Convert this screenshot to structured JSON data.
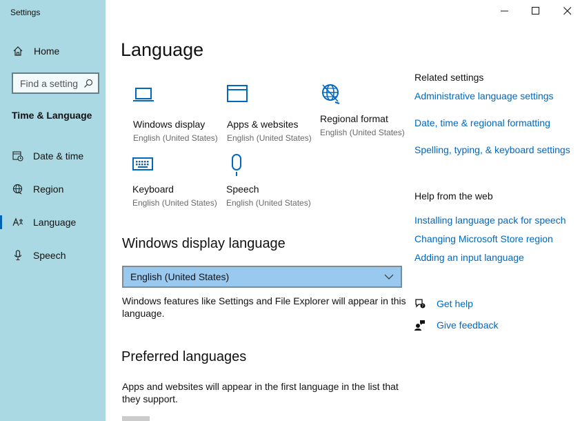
{
  "window": {
    "app_title": "Settings"
  },
  "sidebar": {
    "home_label": "Home",
    "search_placeholder": "Find a setting",
    "section_title": "Time & Language",
    "items": [
      {
        "label": "Date & time",
        "icon": "calendar-clock-icon"
      },
      {
        "label": "Region",
        "icon": "globe-icon"
      },
      {
        "label": "Language",
        "icon": "language-icon",
        "active": true
      },
      {
        "label": "Speech",
        "icon": "microphone-icon"
      }
    ]
  },
  "main": {
    "title": "Language",
    "tiles": [
      {
        "name": "Windows display",
        "sub": "English (United States)",
        "icon": "monitor-icon"
      },
      {
        "name": "Apps & websites",
        "sub": "English (United States)",
        "icon": "window-icon"
      },
      {
        "name": "Regional format",
        "sub": "English (United States)",
        "icon": "regional-globe-icon"
      },
      {
        "name": "Keyboard",
        "sub": "English (United States)",
        "icon": "keyboard-icon"
      },
      {
        "name": "Speech",
        "sub": "English (United States)",
        "icon": "microphone-icon"
      }
    ],
    "display_language": {
      "heading": "Windows display language",
      "selected": "English (United States)",
      "description": "Windows features like Settings and File Explorer will appear in this language."
    },
    "preferred": {
      "heading": "Preferred languages",
      "description": "Apps and websites will appear in the first language in the list that they support."
    }
  },
  "related": {
    "title": "Related settings",
    "links": [
      "Administrative language settings",
      "Date, time & regional formatting",
      "Spelling, typing, & keyboard settings"
    ]
  },
  "help_web": {
    "title": "Help from the web",
    "links": [
      "Installing language pack for speech",
      "Changing Microsoft Store region",
      "Adding an input language"
    ]
  },
  "support": {
    "get_help": "Get help",
    "give_feedback": "Give feedback"
  },
  "colors": {
    "sidebar_bg": "#aad8e3",
    "accent": "#0067c0",
    "dropdown_bg": "#99c9ef"
  }
}
